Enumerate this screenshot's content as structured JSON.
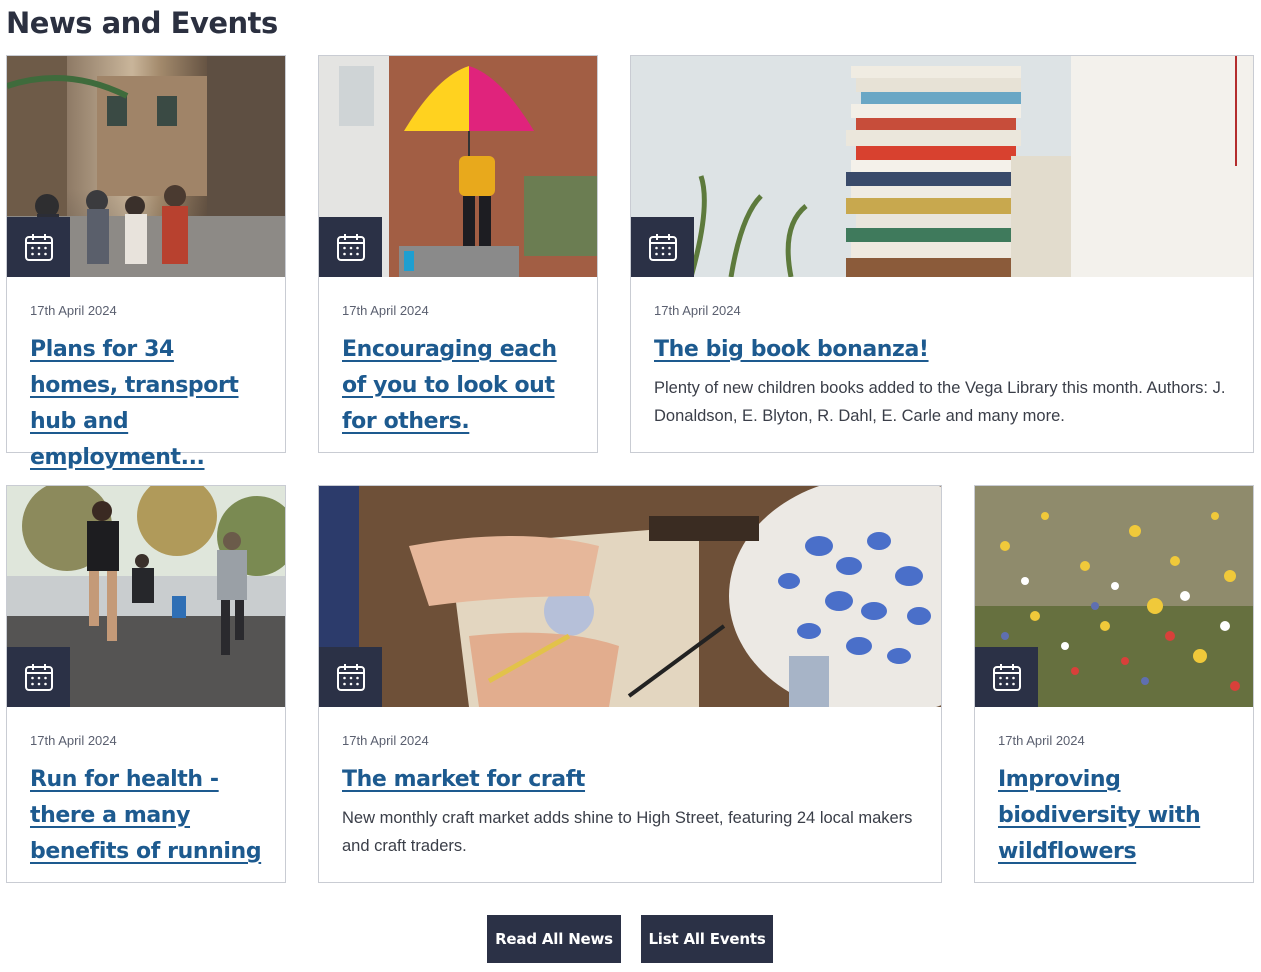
{
  "section": {
    "title": "News and Events"
  },
  "cards": [
    {
      "date": "17th April 2024",
      "title": "Plans for 34 homes, transport hub and employment...",
      "description": "",
      "image_icon": "calendar-icon"
    },
    {
      "date": "17th April 2024",
      "title": "Encouraging each of you to look out for others.",
      "description": "",
      "image_icon": "calendar-icon"
    },
    {
      "date": "17th April 2024",
      "title": "The big book bonanza!",
      "description": "Plenty of new children books added to the Vega Library this month. Authors: J. Donaldson, E. Blyton, R. Dahl, E. Carle and many more.",
      "image_icon": "calendar-icon"
    },
    {
      "date": "17th April 2024",
      "title": "Run for health - there a many benefits of running",
      "description": "",
      "image_icon": "calendar-icon"
    },
    {
      "date": "17th April 2024",
      "title": "The market for craft",
      "description": "New monthly craft market adds shine to High Street, featuring 24 local makers and craft traders.",
      "image_icon": "calendar-icon"
    },
    {
      "date": "17th April 2024",
      "title": "Improving biodiversity with wildflowers",
      "description": "",
      "image_icon": "calendar-icon"
    }
  ],
  "buttons": {
    "read_all_news": "Read All News",
    "list_all_events": "List All Events"
  },
  "colors": {
    "accent": "#1d5a8f",
    "dark": "#2b3146",
    "border": "#c9ccd3"
  }
}
